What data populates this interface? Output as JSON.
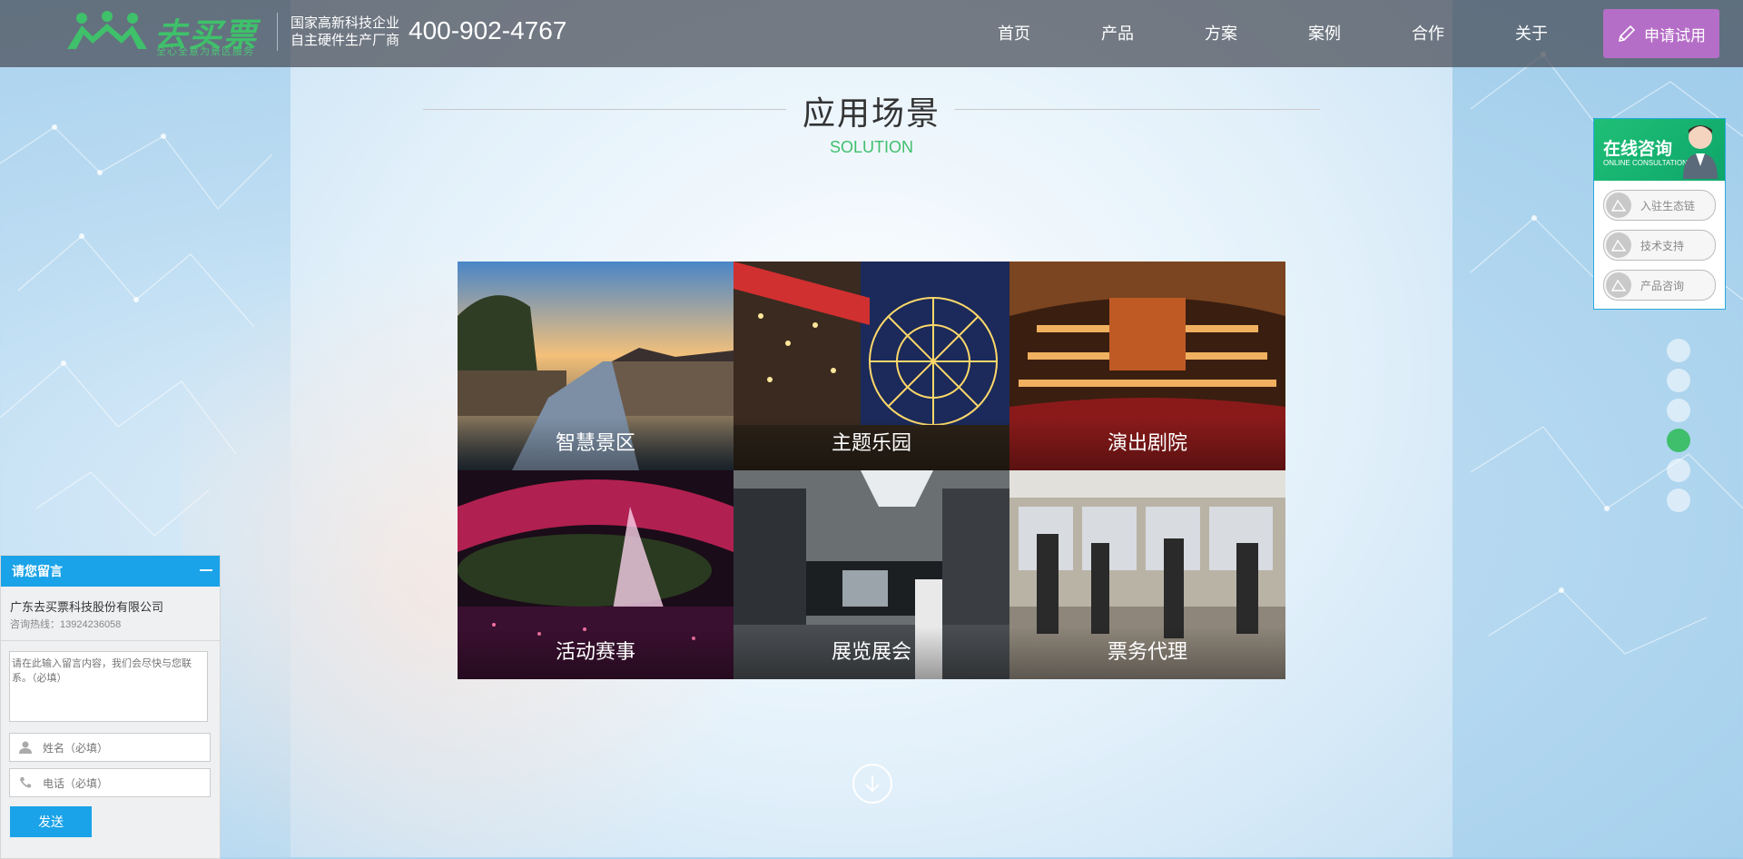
{
  "header": {
    "logo_text": "去买票",
    "logo_slogan": "全心全意为景区服务",
    "tagline_line1": "国家高新科技企业",
    "tagline_line2": "自主硬件生产厂商",
    "phone": "400-902-4767",
    "nav": [
      "首页",
      "产品",
      "方案",
      "案例",
      "合作",
      "关于"
    ],
    "apply_label": "申请试用"
  },
  "section": {
    "title": "应用场景",
    "subtitle": "SOLUTION"
  },
  "scenes": [
    "智慧景区",
    "主题乐园",
    "演出剧院",
    "活动赛事",
    "展览展会",
    "票务代理"
  ],
  "consult": {
    "title": "在线咨询",
    "subtitle": "ONLINE CONSULTATION",
    "items": [
      "入驻生态链",
      "技术支持",
      "产品咨询"
    ]
  },
  "message": {
    "title": "请您留言",
    "company": "广东去买票科技股份有限公司",
    "hotline": "咨询热线：13924236058",
    "content_placeholder": "请在此输入留言内容，我们会尽快与您联系。（必填）",
    "name_placeholder": "姓名（必填）",
    "phone_placeholder": "电话（必填）",
    "send_label": "发送"
  },
  "colors": {
    "brand_green": "#3fbf6c",
    "apply_purple": "#b56ec7",
    "message_blue": "#1aa3e8"
  }
}
